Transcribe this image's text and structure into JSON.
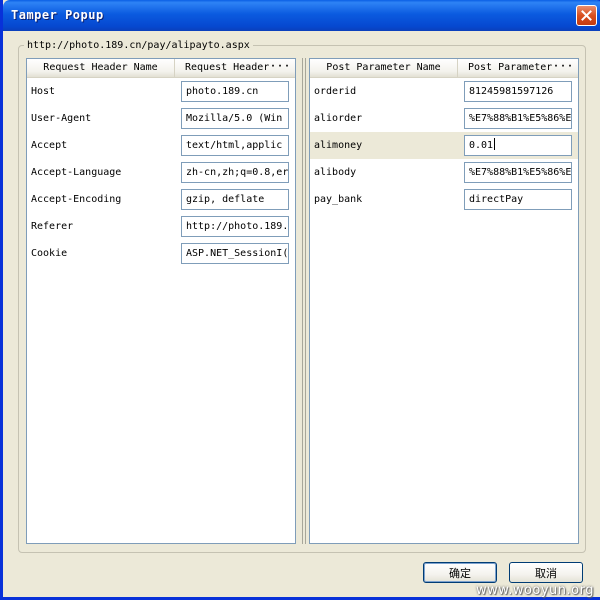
{
  "window": {
    "title": "Tamper Popup"
  },
  "url": "http://photo.189.cn/pay/alipayto.aspx",
  "headers_table": {
    "col_name": "Request Header Name",
    "col_value": "Request Header",
    "more": "···",
    "rows": [
      {
        "name": "Host",
        "value": "photo.189.cn"
      },
      {
        "name": "User-Agent",
        "value": "Mozilla/5.0 (Win"
      },
      {
        "name": "Accept",
        "value": "text/html,applic"
      },
      {
        "name": "Accept-Language",
        "value": "zh-cn,zh;q=0.8,er"
      },
      {
        "name": "Accept-Encoding",
        "value": "gzip, deflate"
      },
      {
        "name": "Referer",
        "value": "http://photo.189."
      },
      {
        "name": "Cookie",
        "value": "ASP.NET_SessionI("
      }
    ]
  },
  "params_table": {
    "col_name": "Post Parameter Name",
    "col_value": "Post Parameter",
    "more": "···",
    "rows": [
      {
        "name": "orderid",
        "value": "81245981597126"
      },
      {
        "name": "aliorder",
        "value": "%E7%88%B1%E5%86%E"
      },
      {
        "name": "alimoney",
        "value": "0.01"
      },
      {
        "name": "alibody",
        "value": "%E7%88%B1%E5%86%E"
      },
      {
        "name": "pay_bank",
        "value": "directPay"
      }
    ]
  },
  "buttons": {
    "ok": "确定",
    "cancel": "取消"
  },
  "watermark": "www.wooyun.org",
  "icons": {
    "close": "close-icon",
    "more": "ellipsis-icon"
  },
  "colors": {
    "titlebar": "#0b5be0",
    "close": "#d9501f",
    "face": "#ece9d8",
    "border": "#7f9db9"
  }
}
